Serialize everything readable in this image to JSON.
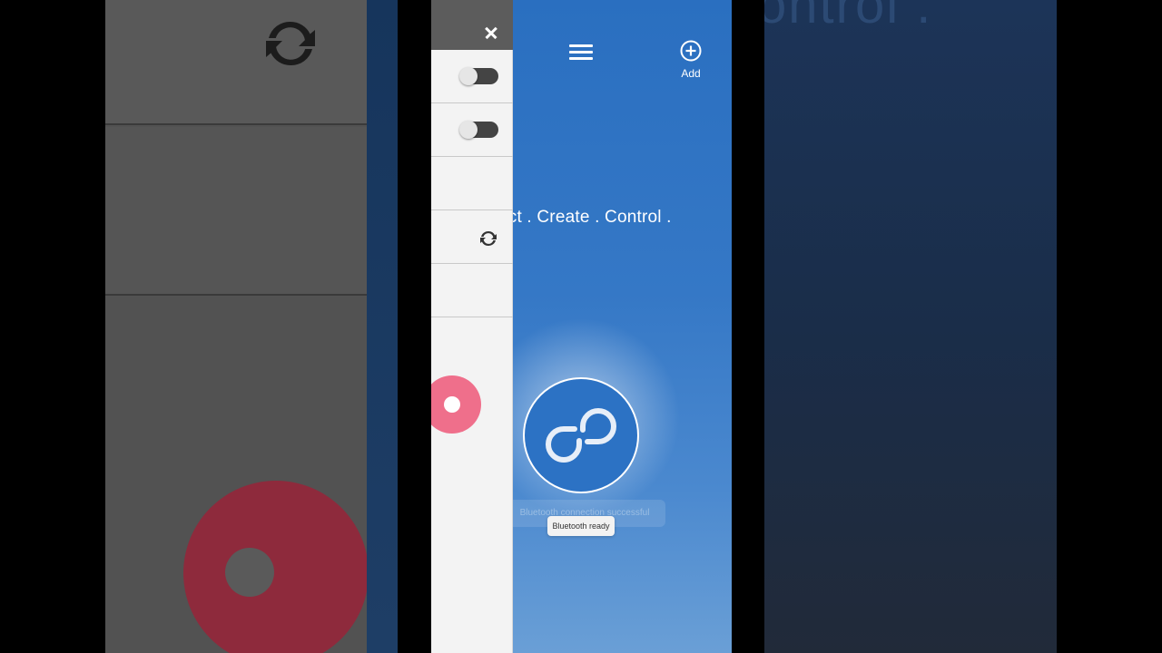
{
  "header": {
    "menu_icon": "hamburger-menu-icon",
    "add_icon": "plus-circle-icon",
    "add_label": "Add"
  },
  "main": {
    "tagline": "ect . Create . Control .",
    "logo_icon": "bluetooth-link-logo-icon",
    "faded_notification": "Bluetooth connection successful",
    "toast": "Bluetooth ready"
  },
  "drawer": {
    "close_icon": "close-x-icon",
    "rows": [
      {
        "type": "toggle",
        "state": "off"
      },
      {
        "type": "toggle",
        "state": "off"
      },
      {
        "type": "empty"
      },
      {
        "type": "refresh",
        "icon": "refresh-icon"
      },
      {
        "type": "empty"
      }
    ],
    "fab_icon": "record-button-icon"
  },
  "colors": {
    "primary_blue": "#2a6fc0",
    "drawer_header": "#5c5c5c",
    "drawer_bg": "#f3f3f3",
    "fab_pink": "#ef6f8b",
    "toggle_track": "#444444"
  }
}
